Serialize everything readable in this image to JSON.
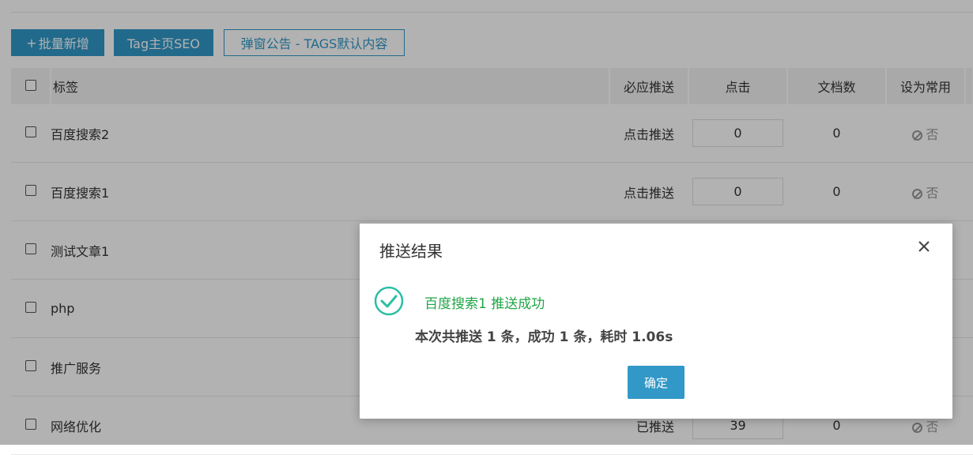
{
  "toolbar": {
    "batch_add_icon": "plus-icon",
    "batch_add_label": "批量新增",
    "tag_seo_label": "Tag主页SEO",
    "popup_label": "弹窗公告 - TAGS默认内容"
  },
  "table": {
    "headers": {
      "label": "标签",
      "push": "必应推送",
      "clicks": "点击",
      "docs": "文档数",
      "common": "设为常用"
    },
    "rows": [
      {
        "label": "百度搜索2",
        "push": "点击推送",
        "clicks": "0",
        "docs": "0",
        "common": "否"
      },
      {
        "label": "百度搜索1",
        "push": "点击推送",
        "clicks": "0",
        "docs": "0",
        "common": "否"
      },
      {
        "label": "测试文章1",
        "push": "",
        "clicks": "",
        "docs": "",
        "common": ""
      },
      {
        "label": "php",
        "push": "",
        "clicks": "",
        "docs": "",
        "common": ""
      },
      {
        "label": "推广服务",
        "push": "",
        "clicks": "",
        "docs": "",
        "common": ""
      },
      {
        "label": "网络优化",
        "push": "已推送",
        "clicks": "39",
        "docs": "0",
        "common": "否"
      }
    ]
  },
  "dialog": {
    "title": "推送结果",
    "success_message": "百度搜索1 推送成功",
    "summary": "本次共推送 1 条，成功 1 条，耗时 1.06s",
    "ok_label": "确定",
    "success_color": "#21a547",
    "close_icon": "close-icon",
    "status_icon": "check-circle-icon"
  },
  "colors": {
    "primary": "#3198c7",
    "overlay": "rgba(0,0,0,0.3)"
  }
}
